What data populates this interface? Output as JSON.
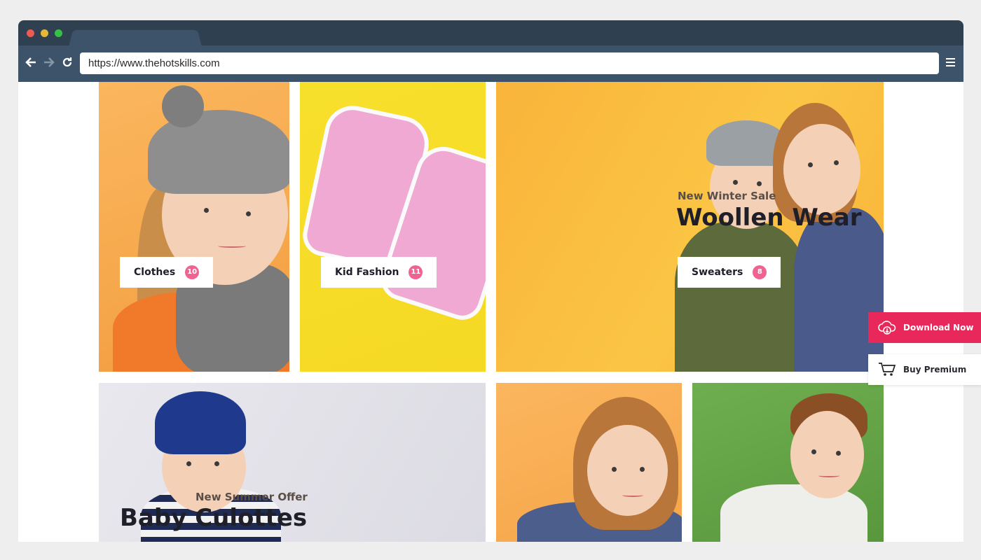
{
  "browser": {
    "url": "https://www.thehotskills.com"
  },
  "categories": [
    {
      "label": "Clothes",
      "count": "10"
    },
    {
      "label": "Kid Fashion",
      "count": "11"
    },
    {
      "label": "Sweaters",
      "count": "8"
    }
  ],
  "promos": [
    {
      "subtitle": "New Winter Sale",
      "title": "Woollen Wear"
    },
    {
      "subtitle": "New Summer Offer",
      "title": "Baby Culottes"
    }
  ],
  "floating_buttons": {
    "download_label": "Download Now",
    "premium_label": "Buy Premium"
  },
  "colors": {
    "accent_pink": "#e8285a",
    "badge_pink": "#f06292",
    "frame": "#2f4050"
  },
  "icons": [
    "back-arrow-icon",
    "forward-arrow-icon",
    "reload-icon",
    "hamburger-menu-icon",
    "cloud-download-icon",
    "cart-icon"
  ]
}
